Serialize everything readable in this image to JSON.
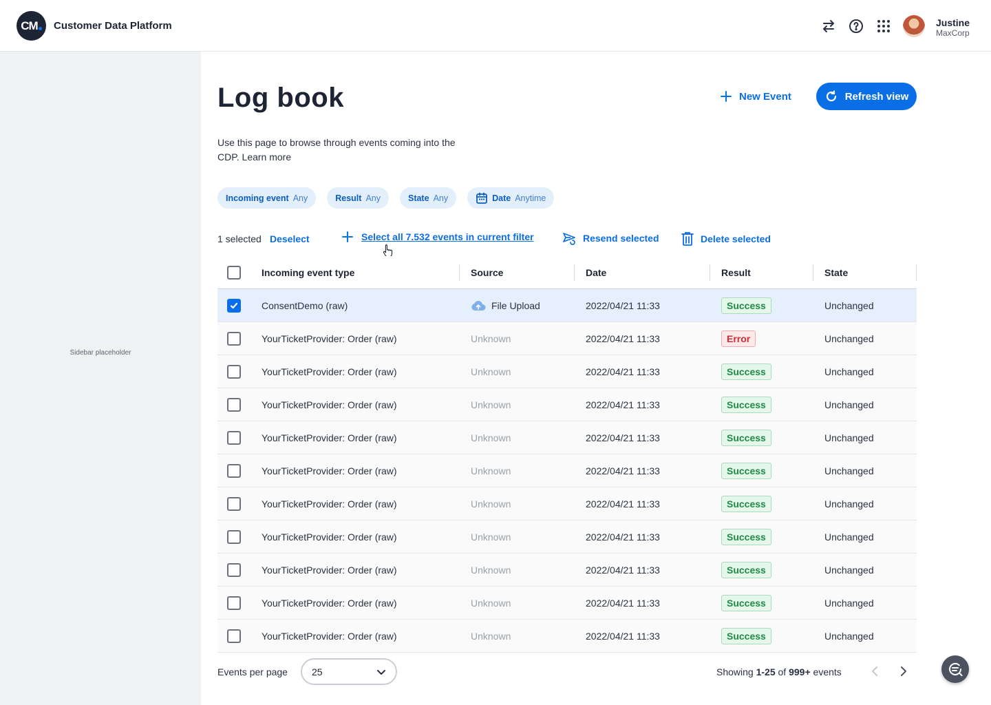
{
  "app": {
    "logo_text": "CM",
    "name": "Customer Data Platform"
  },
  "user": {
    "name": "Justine",
    "org": "MaxCorp"
  },
  "sidebar": {
    "placeholder": "Sidebar placeholder"
  },
  "page": {
    "title": "Log book",
    "description": "Use this page to browse through events coming into the CDP. Learn more",
    "new_event_label": "New Event",
    "refresh_label": "Refresh view"
  },
  "filters": [
    {
      "key": "Incoming event",
      "value": "Any"
    },
    {
      "key": "Result",
      "value": "Any"
    },
    {
      "key": "State",
      "value": "Any"
    },
    {
      "key": "Date",
      "value": "Anytime",
      "icon": "calendar-icon"
    }
  ],
  "toolbar": {
    "selected_count": "1 selected",
    "deselect": "Deselect",
    "select_all": "Select all 7.532 events in current filter",
    "resend": "Resend selected",
    "delete": "Delete selected"
  },
  "table": {
    "columns": [
      "Incoming event type",
      "Source",
      "Date",
      "Result",
      "State"
    ],
    "rows": [
      {
        "checked": true,
        "type": "ConsentDemo (raw)",
        "source": "File Upload",
        "source_icon": "cloud-upload-icon",
        "date": "2022/04/21 11:33",
        "result": "Success",
        "state": "Unchanged"
      },
      {
        "checked": false,
        "type": "YourTicketProvider: Order (raw)",
        "source": "Unknown",
        "date": "2022/04/21 11:33",
        "result": "Error",
        "state": "Unchanged"
      },
      {
        "checked": false,
        "type": "YourTicketProvider: Order (raw)",
        "source": "Unknown",
        "date": "2022/04/21 11:33",
        "result": "Success",
        "state": "Unchanged"
      },
      {
        "checked": false,
        "type": "YourTicketProvider: Order (raw)",
        "source": "Unknown",
        "date": "2022/04/21 11:33",
        "result": "Success",
        "state": "Unchanged"
      },
      {
        "checked": false,
        "type": "YourTicketProvider: Order (raw)",
        "source": "Unknown",
        "date": "2022/04/21 11:33",
        "result": "Success",
        "state": "Unchanged"
      },
      {
        "checked": false,
        "type": "YourTicketProvider: Order (raw)",
        "source": "Unknown",
        "date": "2022/04/21 11:33",
        "result": "Success",
        "state": "Unchanged"
      },
      {
        "checked": false,
        "type": "YourTicketProvider: Order (raw)",
        "source": "Unknown",
        "date": "2022/04/21 11:33",
        "result": "Success",
        "state": "Unchanged"
      },
      {
        "checked": false,
        "type": "YourTicketProvider: Order (raw)",
        "source": "Unknown",
        "date": "2022/04/21 11:33",
        "result": "Success",
        "state": "Unchanged"
      },
      {
        "checked": false,
        "type": "YourTicketProvider: Order (raw)",
        "source": "Unknown",
        "date": "2022/04/21 11:33",
        "result": "Success",
        "state": "Unchanged"
      },
      {
        "checked": false,
        "type": "YourTicketProvider: Order (raw)",
        "source": "Unknown",
        "date": "2022/04/21 11:33",
        "result": "Success",
        "state": "Unchanged"
      },
      {
        "checked": false,
        "type": "YourTicketProvider: Order (raw)",
        "source": "Unknown",
        "date": "2022/04/21 11:33",
        "result": "Success",
        "state": "Unchanged"
      }
    ]
  },
  "footer": {
    "per_page_label": "Events per page",
    "per_page_value": "25",
    "showing_prefix": "Showing",
    "showing_range": "1-25",
    "showing_of": "of",
    "showing_total": "999+",
    "showing_suffix": "events"
  },
  "colors": {
    "accent": "#0a6ee6",
    "success": "#1f8c44",
    "error": "#d02a34",
    "selected_row": "#e6f0fc"
  }
}
